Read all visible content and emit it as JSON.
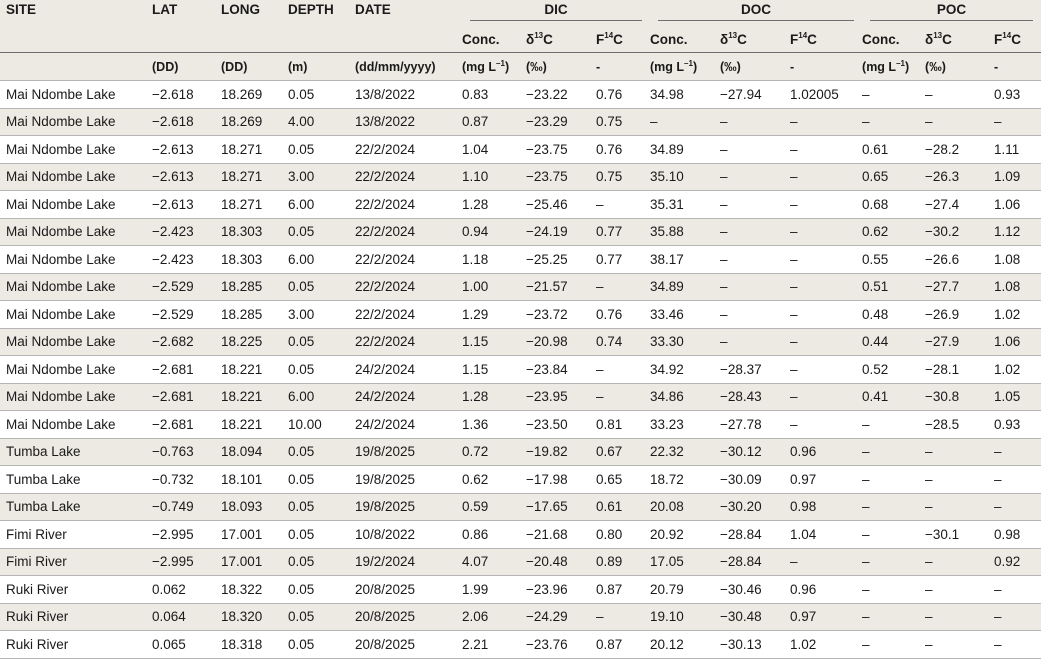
{
  "header": {
    "site": "SITE",
    "lat": "LAT",
    "long": "LONG",
    "depth": "DEPTH",
    "date": "DATE",
    "dic": "DIC",
    "doc": "DOC",
    "poc": "POC",
    "conc": "Conc.",
    "d13c_prefix": "δ",
    "d13c_sup": "13",
    "d13c_suffix": "C",
    "f14c_prefix": "F",
    "f14c_sup": "14",
    "f14c_suffix": "C",
    "unit_lat": "(DD)",
    "unit_long": "(DD)",
    "unit_depth": "(m)",
    "unit_date": "(dd/mm/yyyy)",
    "unit_conc_prefix": "(mg L",
    "unit_conc_sup": "–1",
    "unit_conc_suffix": ")",
    "unit_permil": "(‰)",
    "unit_none": "-"
  },
  "rows": [
    [
      "Mai Ndombe Lake",
      "−2.618",
      "18.269",
      "0.05",
      "13/8/2022",
      "0.83",
      "−23.22",
      "0.76",
      "34.98",
      "−27.94",
      "1.02005",
      "–",
      "–",
      "0.93"
    ],
    [
      "Mai Ndombe Lake",
      "−2.618",
      "18.269",
      "4.00",
      "13/8/2022",
      "0.87",
      "−23.29",
      "0.75",
      "–",
      "–",
      "–",
      "–",
      "–",
      "–"
    ],
    [
      "Mai Ndombe Lake",
      "−2.613",
      "18.271",
      "0.05",
      "22/2/2024",
      "1.04",
      "−23.75",
      "0.76",
      "34.89",
      "–",
      "–",
      "0.61",
      "−28.2",
      "1.11"
    ],
    [
      "Mai Ndombe Lake",
      "−2.613",
      "18.271",
      "3.00",
      "22/2/2024",
      "1.10",
      "−23.75",
      "0.75",
      "35.10",
      "–",
      "–",
      "0.65",
      "−26.3",
      "1.09"
    ],
    [
      "Mai Ndombe Lake",
      "−2.613",
      "18.271",
      "6.00",
      "22/2/2024",
      "1.28",
      "−25.46",
      "–",
      "35.31",
      "–",
      "–",
      "0.68",
      "−27.4",
      "1.06"
    ],
    [
      "Mai Ndombe Lake",
      "−2.423",
      "18.303",
      "0.05",
      "22/2/2024",
      "0.94",
      "−24.19",
      "0.77",
      "35.88",
      "–",
      "–",
      "0.62",
      "−30.2",
      "1.12"
    ],
    [
      "Mai Ndombe Lake",
      "−2.423",
      "18.303",
      "6.00",
      "22/2/2024",
      "1.18",
      "−25.25",
      "0.77",
      "38.17",
      "–",
      "–",
      "0.55",
      "−26.6",
      "1.08"
    ],
    [
      "Mai Ndombe Lake",
      "−2.529",
      "18.285",
      "0.05",
      "22/2/2024",
      "1.00",
      "−21.57",
      "–",
      "34.89",
      "–",
      "–",
      "0.51",
      "−27.7",
      "1.08"
    ],
    [
      "Mai Ndombe Lake",
      "−2.529",
      "18.285",
      "3.00",
      "22/2/2024",
      "1.29",
      "−23.72",
      "0.76",
      "33.46",
      "–",
      "–",
      "0.48",
      "−26.9",
      "1.02"
    ],
    [
      "Mai Ndombe Lake",
      "−2.682",
      "18.225",
      "0.05",
      "22/2/2024",
      "1.15",
      "−20.98",
      "0.74",
      "33.30",
      "–",
      "–",
      "0.44",
      "−27.9",
      "1.06"
    ],
    [
      "Mai Ndombe Lake",
      "−2.681",
      "18.221",
      "0.05",
      "24/2/2024",
      "1.15",
      "−23.84",
      "–",
      "34.92",
      "−28.37",
      "–",
      "0.52",
      "−28.1",
      "1.02"
    ],
    [
      "Mai Ndombe Lake",
      "−2.681",
      "18.221",
      "6.00",
      "24/2/2024",
      "1.28",
      "−23.95",
      "–",
      "34.86",
      "−28.43",
      "–",
      "0.41",
      "−30.8",
      "1.05"
    ],
    [
      "Mai Ndombe Lake",
      "−2.681",
      "18.221",
      "10.00",
      "24/2/2024",
      "1.36",
      "−23.50",
      "0.81",
      "33.23",
      "−27.78",
      "–",
      "–",
      "−28.5",
      "0.93"
    ],
    [
      "Tumba Lake",
      "−0.763",
      "18.094",
      "0.05",
      "19/8/2025",
      "0.72",
      "−19.82",
      "0.67",
      "22.32",
      "−30.12",
      "0.96",
      "–",
      "–",
      "–"
    ],
    [
      "Tumba Lake",
      "−0.732",
      "18.101",
      "0.05",
      "19/8/2025",
      "0.62",
      "−17.98",
      "0.65",
      "18.72",
      "−30.09",
      "0.97",
      "–",
      "–",
      "–"
    ],
    [
      "Tumba Lake",
      "−0.749",
      "18.093",
      "0.05",
      "19/8/2025",
      "0.59",
      "−17.65",
      "0.61",
      "20.08",
      "−30.20",
      "0.98",
      "–",
      "–",
      "–"
    ],
    [
      "Fimi River",
      "−2.995",
      "17.001",
      "0.05",
      "10/8/2022",
      "0.86",
      "−21.68",
      "0.80",
      "20.92",
      "−28.84",
      "1.04",
      "–",
      "−30.1",
      "0.98"
    ],
    [
      "Fimi River",
      "−2.995",
      "17.001",
      "0.05",
      "19/2/2024",
      "4.07",
      "−20.48",
      "0.89",
      "17.05",
      "−28.84",
      "–",
      "–",
      "–",
      "0.92"
    ],
    [
      "Ruki River",
      "0.062",
      "18.322",
      "0.05",
      "20/8/2025",
      "1.99",
      "−23.96",
      "0.87",
      "20.79",
      "−30.46",
      "0.96",
      "–",
      "–",
      "–"
    ],
    [
      "Ruki River",
      "0.064",
      "18.320",
      "0.05",
      "20/8/2025",
      "2.06",
      "−24.29",
      "–",
      "19.10",
      "−30.48",
      "0.97",
      "–",
      "–",
      "–"
    ],
    [
      "Ruki River",
      "0.065",
      "18.318",
      "0.05",
      "20/8/2025",
      "2.21",
      "−23.76",
      "0.87",
      "20.12",
      "−30.13",
      "1.02",
      "–",
      "–",
      "–"
    ]
  ]
}
